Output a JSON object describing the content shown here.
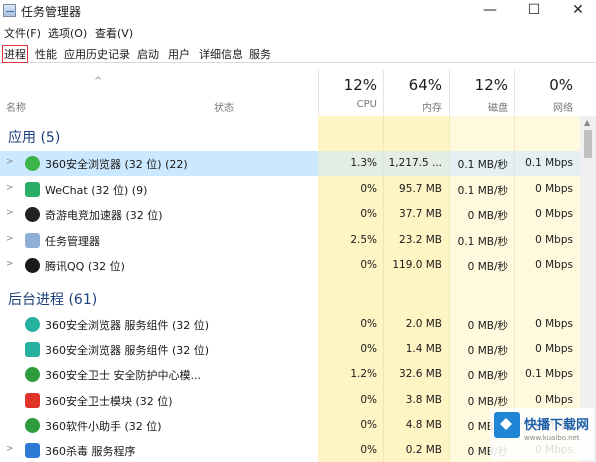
{
  "window": {
    "title": "任务管理器",
    "minimize": "—",
    "maximize": "☐",
    "close": "✕"
  },
  "menu": [
    "文件(F)",
    "选项(O)",
    "查看(V)"
  ],
  "tabs": [
    "进程",
    "性能",
    "应用历史记录",
    "启动",
    "用户",
    "详细信息",
    "服务"
  ],
  "columns": {
    "sort_arrow": "^",
    "name": "名称",
    "status": "状态",
    "cpu": {
      "pct": "12%",
      "label": "CPU"
    },
    "mem": {
      "pct": "64%",
      "label": "内存"
    },
    "disk": {
      "pct": "12%",
      "label": "磁盘"
    },
    "net": {
      "pct": "0%",
      "label": "网络"
    }
  },
  "groups": {
    "apps": "应用 (5)",
    "background": "后台进程 (61)"
  },
  "apps": [
    {
      "name": "360安全浏览器 (32 位) (22)",
      "cpu": "1.3%",
      "mem": "1,217.5 ...",
      "disk": "0.1 MB/秒",
      "net": "0.1 Mbps",
      "icon": "browser-360-icon",
      "color": "#3cb44a"
    },
    {
      "name": "WeChat (32 位) (9)",
      "cpu": "0%",
      "mem": "95.7 MB",
      "disk": "0.1 MB/秒",
      "net": "0 Mbps",
      "icon": "wechat-icon",
      "color": "#2aae67"
    },
    {
      "name": "奇游电竞加速器 (32 位)",
      "cpu": "0%",
      "mem": "37.7 MB",
      "disk": "0 MB/秒",
      "net": "0 Mbps",
      "icon": "qiyou-icon",
      "color": "#222222"
    },
    {
      "name": "任务管理器",
      "cpu": "2.5%",
      "mem": "23.2 MB",
      "disk": "0.1 MB/秒",
      "net": "0 Mbps",
      "icon": "task-manager-icon",
      "color": "#8fb0d6"
    },
    {
      "name": "腾讯QQ (32 位)",
      "cpu": "0%",
      "mem": "119.0 MB",
      "disk": "0 MB/秒",
      "net": "0 Mbps",
      "icon": "qq-penguin-icon",
      "color": "#1a1a1a"
    }
  ],
  "background": [
    {
      "name": "360安全浏览器 服务组件 (32 位)",
      "cpu": "0%",
      "mem": "2.0 MB",
      "disk": "0 MB/秒",
      "net": "0 Mbps",
      "icon": "browser-service-icon",
      "color": "#26b0a0"
    },
    {
      "name": "360安全浏览器 服务组件 (32 位)",
      "cpu": "0%",
      "mem": "1.4 MB",
      "disk": "0 MB/秒",
      "net": "0 Mbps",
      "icon": "browser-service-icon",
      "color": "#26b0a0"
    },
    {
      "name": "360安全卫士 安全防护中心模...",
      "cpu": "1.2%",
      "mem": "32.6 MB",
      "disk": "0 MB/秒",
      "net": "0.1 Mbps",
      "icon": "360-guard-icon",
      "color": "#2e9b3c"
    },
    {
      "name": "360安全卫士模块 (32 位)",
      "cpu": "0%",
      "mem": "3.8 MB",
      "disk": "0 MB/秒",
      "net": "0 Mbps",
      "icon": "360-module-icon",
      "color": "#e0342b"
    },
    {
      "name": "360软件小助手 (32 位)",
      "cpu": "0%",
      "mem": "4.8 MB",
      "disk": "0 MB/秒",
      "net": "0 Mbps",
      "icon": "360-helper-icon",
      "color": "#2e9b3c"
    },
    {
      "name": "360杀毒 服务程序",
      "cpu": "0%",
      "mem": "0.2 MB",
      "disk": "0 MB/秒",
      "net": "0 Mbps",
      "icon": "360-antivirus-icon",
      "color": "#2e7bd6"
    }
  ],
  "watermark": {
    "text": "快播下载网",
    "sub": "www.kuaibo.net"
  }
}
